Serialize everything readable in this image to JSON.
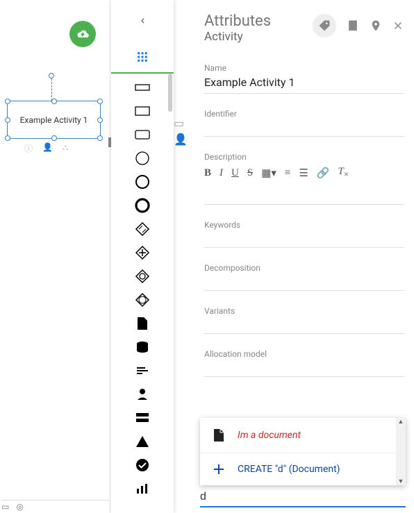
{
  "canvas": {
    "node_label": "Example Activity 1"
  },
  "palette": {
    "tooltip_back": "Back"
  },
  "panel": {
    "title": "Attributes",
    "subtitle": "Activity",
    "fields": {
      "name_label": "Name",
      "name_value": "Example Activity 1",
      "identifier_label": "Identifier",
      "description_label": "Description",
      "keywords_label": "Keywords",
      "decomposition_label": "Decomposition",
      "variants_label": "Variants",
      "allocation_label": "Allocation model"
    }
  },
  "autocomplete": {
    "doc_label": "Im a document",
    "create_label": "CREATE \"d\" (Document)",
    "input_value": "d"
  }
}
